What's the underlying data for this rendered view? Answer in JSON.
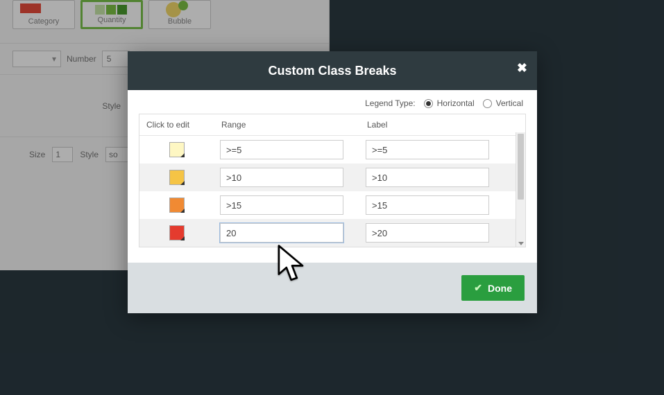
{
  "background": {
    "cards": {
      "category": "Category",
      "quantity": "Quantity",
      "bubble": "Bubble"
    },
    "number_label": "Number",
    "number_value": "5",
    "style_label": "Style",
    "size_label": "Size",
    "size_value": "1",
    "style2_label": "Style",
    "style2_value": "so"
  },
  "modal": {
    "title": "Custom Class Breaks",
    "legend_label": "Legend Type:",
    "legend_options": {
      "horizontal": "Horizontal",
      "vertical": "Vertical"
    },
    "legend_selected": "horizontal",
    "headers": {
      "click": "Click to edit",
      "range": "Range",
      "label": "Label"
    },
    "rows": [
      {
        "color": "#fef7c3",
        "range": ">=5",
        "label": ">=5"
      },
      {
        "color": "#f5c445",
        "range": ">10",
        "label": ">10"
      },
      {
        "color": "#f08a33",
        "range": ">15",
        "label": ">15"
      },
      {
        "color": "#e43b2e",
        "range": "20",
        "label": ">20"
      }
    ],
    "done_label": "Done"
  }
}
